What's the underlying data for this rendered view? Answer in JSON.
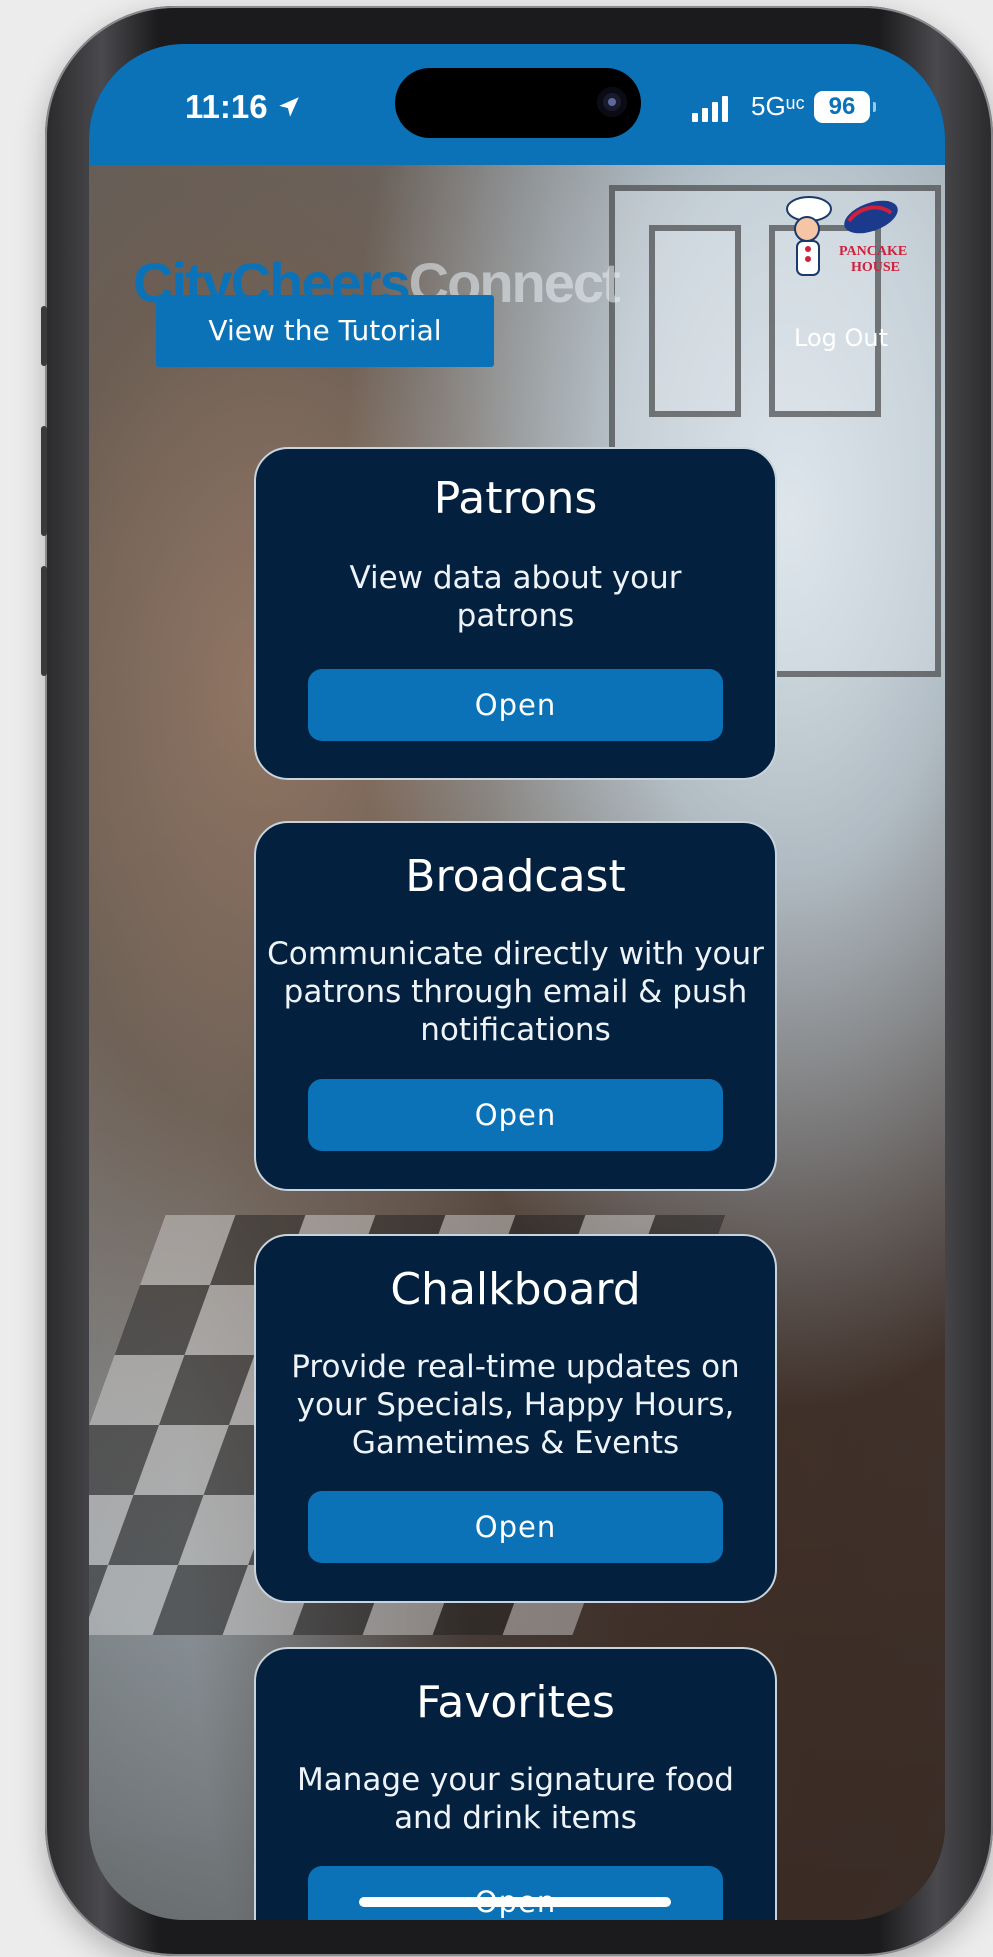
{
  "status_bar": {
    "time": "11:16",
    "network": "5Gᵘᶜ",
    "battery": "96"
  },
  "header": {
    "brand_part1": "CityCheers",
    "brand_part2": "Connect",
    "tutorial_button": "View the Tutorial",
    "logout": "Log Out"
  },
  "cards": [
    {
      "title": "Patrons",
      "description": "View data about your patrons",
      "button": "Open"
    },
    {
      "title": "Broadcast",
      "description": "Communicate directly with your patrons through email & push notifications",
      "button": "Open"
    },
    {
      "title": "Chalkboard",
      "description": "Provide real-time updates on your Specials, Happy Hours, Gametimes & Events",
      "button": "Open"
    },
    {
      "title": "Favorites",
      "description": "Manage your signature food and drink items",
      "button": "Open"
    }
  ],
  "colors": {
    "accent": "#0c72b8",
    "card_bg": "#03203f"
  }
}
